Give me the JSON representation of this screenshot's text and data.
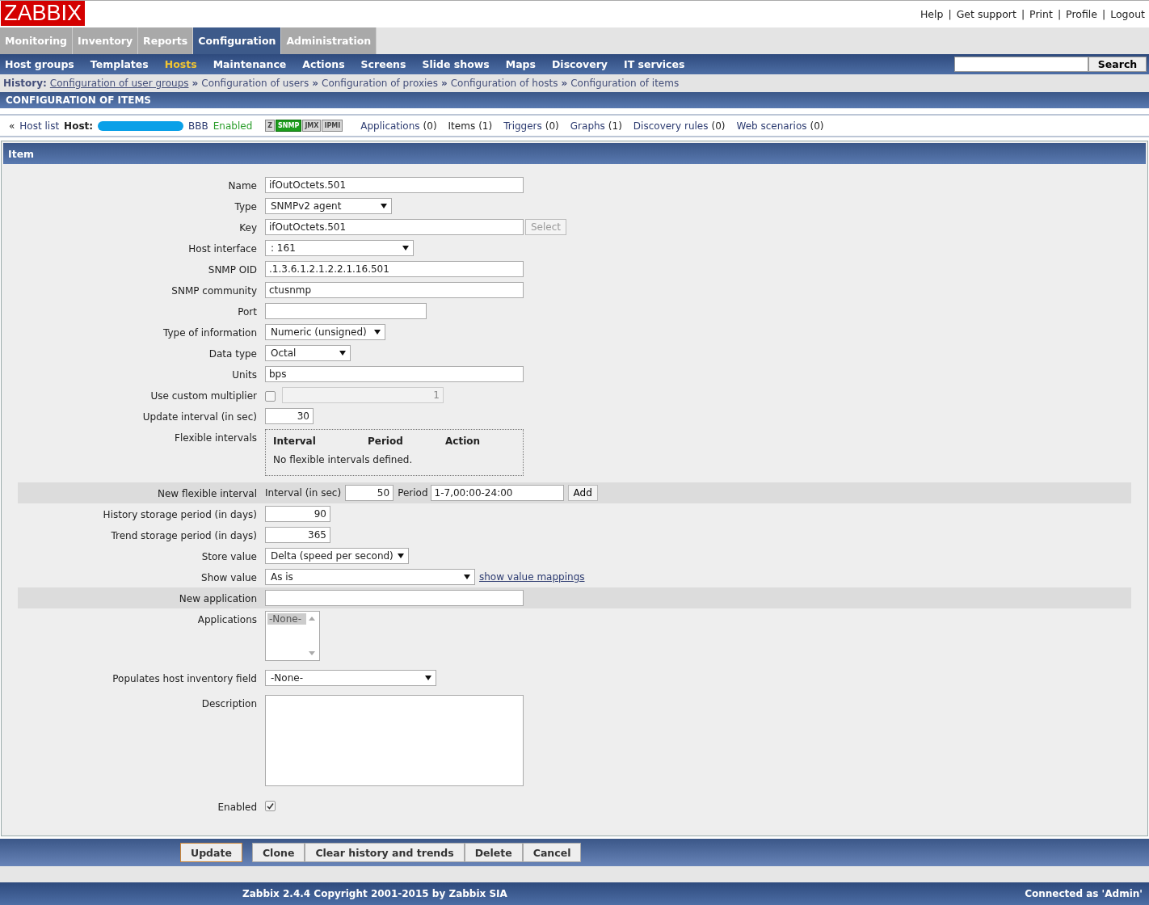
{
  "header": {
    "logo": "ZABBIX",
    "top_links": [
      "Help",
      "Get support",
      "Print",
      "Profile",
      "Logout"
    ],
    "separator": "|"
  },
  "main_menu": [
    {
      "label": "Monitoring",
      "selected": false
    },
    {
      "label": "Inventory",
      "selected": false
    },
    {
      "label": "Reports",
      "selected": false
    },
    {
      "label": "Configuration",
      "selected": true
    },
    {
      "label": "Administration",
      "selected": false
    }
  ],
  "sub_menu": [
    {
      "label": "Host groups",
      "selected": false
    },
    {
      "label": "Templates",
      "selected": false
    },
    {
      "label": "Hosts",
      "selected": true
    },
    {
      "label": "Maintenance",
      "selected": false
    },
    {
      "label": "Actions",
      "selected": false
    },
    {
      "label": "Screens",
      "selected": false
    },
    {
      "label": "Slide shows",
      "selected": false
    },
    {
      "label": "Maps",
      "selected": false
    },
    {
      "label": "Discovery",
      "selected": false
    },
    {
      "label": "IT services",
      "selected": false
    }
  ],
  "search": {
    "button": "Search"
  },
  "history": {
    "label": "History:",
    "separator": "»",
    "links": [
      {
        "label": "Configuration of user groups",
        "underlined": true
      },
      {
        "label": "Configuration of users",
        "underlined": false
      },
      {
        "label": "Configuration of proxies",
        "underlined": false
      },
      {
        "label": "Configuration of hosts",
        "underlined": false
      },
      {
        "label": "Configuration of items",
        "underlined": false
      }
    ]
  },
  "page_title": "CONFIGURATION OF ITEMS",
  "host_bar": {
    "prefix": "«",
    "host_list": "Host list",
    "host_label": "Host:",
    "host_name": "BBB",
    "status": "Enabled",
    "availability": [
      {
        "label": "Z",
        "available": false
      },
      {
        "label": "SNMP",
        "available": true
      },
      {
        "label": "JMX",
        "available": false
      },
      {
        "label": "IPMI",
        "available": false
      }
    ],
    "links": [
      {
        "label": "Applications",
        "count": "(0)",
        "link": true
      },
      {
        "label": "Items",
        "count": "(1)",
        "link": false
      },
      {
        "label": "Triggers",
        "count": "(0)",
        "link": true
      },
      {
        "label": "Graphs",
        "count": "(1)",
        "link": true
      },
      {
        "label": "Discovery rules",
        "count": "(0)",
        "link": true
      },
      {
        "label": "Web scenarios",
        "count": "(0)",
        "link": true
      }
    ]
  },
  "form": {
    "title": "Item",
    "fields": [
      {
        "label": "Name",
        "kind": "text",
        "value": "ifOutOctets.501",
        "highlighted": false
      },
      {
        "label": "Type",
        "kind": "select",
        "value": "SNMPv2 agent",
        "highlighted": false
      },
      {
        "label": "Key",
        "kind": "text_button",
        "value": "ifOutOctets.501",
        "button": "Select",
        "button_disabled": true,
        "highlighted": false
      },
      {
        "label": "Host interface",
        "kind": "select",
        "value": ": 161",
        "highlighted": false
      },
      {
        "label": "SNMP OID",
        "kind": "text",
        "value": ".1.3.6.1.2.1.2.2.1.16.501",
        "highlighted": false
      },
      {
        "label": "SNMP community",
        "kind": "text",
        "value": "ctusnmp",
        "highlighted": false
      },
      {
        "label": "Port",
        "kind": "text",
        "highlighted": false
      },
      {
        "label": "Type of information",
        "kind": "select",
        "value": "Numeric (unsigned)",
        "highlighted": false
      },
      {
        "label": "Data type",
        "kind": "select",
        "value": "Octal",
        "highlighted": false
      },
      {
        "label": "Units",
        "kind": "text",
        "value": "bps",
        "highlighted": false
      },
      {
        "label": "Use custom multiplier",
        "kind": "multiplier",
        "checked": false,
        "value": "1",
        "highlighted": false
      },
      {
        "label": "Update interval (in sec)",
        "kind": "number",
        "value": "30",
        "highlighted": false
      },
      {
        "label": "Flexible intervals",
        "kind": "flex_table",
        "columns": [
          "Interval",
          "Period",
          "Action"
        ],
        "empty_text": "No flexible intervals defined.",
        "highlighted": false
      },
      {
        "label": "New flexible interval",
        "kind": "new_flex",
        "interval_label": "Interval (in sec)",
        "interval": "50",
        "period_label": "Period",
        "period": "1-7,00:00-24:00",
        "button": "Add",
        "highlighted": true
      },
      {
        "label": "History storage period (in days)",
        "kind": "number",
        "value": "90",
        "highlighted": false
      },
      {
        "label": "Trend storage period (in days)",
        "kind": "number",
        "value": "365",
        "highlighted": false
      },
      {
        "label": "Store value",
        "kind": "select",
        "value": "Delta (speed per second)",
        "highlighted": false
      },
      {
        "label": "Show value",
        "kind": "select_link",
        "value": "As is",
        "link": "show value mappings",
        "highlighted": false
      },
      {
        "label": "New application",
        "kind": "text",
        "highlighted": true
      },
      {
        "label": "Applications",
        "kind": "listbox",
        "options": [
          {
            "label": "-None-",
            "selected": true
          }
        ],
        "highlighted": false
      },
      {
        "label": "Populates host inventory field",
        "kind": "select",
        "value": "-None-",
        "highlighted": false
      },
      {
        "label": "Description",
        "kind": "textarea",
        "highlighted": false
      },
      {
        "label": "Enabled",
        "kind": "checkbox",
        "checked": true,
        "highlighted": false
      }
    ]
  },
  "buttons": [
    {
      "label": "Update",
      "primary": true
    },
    {
      "label": "Clone",
      "primary": false
    },
    {
      "label": "Clear history and trends",
      "primary": false
    },
    {
      "label": "Delete",
      "primary": false
    },
    {
      "label": "Cancel",
      "primary": false
    }
  ],
  "footer": {
    "copyright": "Zabbix 2.4.4 Copyright 2001-2015 by Zabbix SIA",
    "connected": "Connected as 'Admin'"
  }
}
